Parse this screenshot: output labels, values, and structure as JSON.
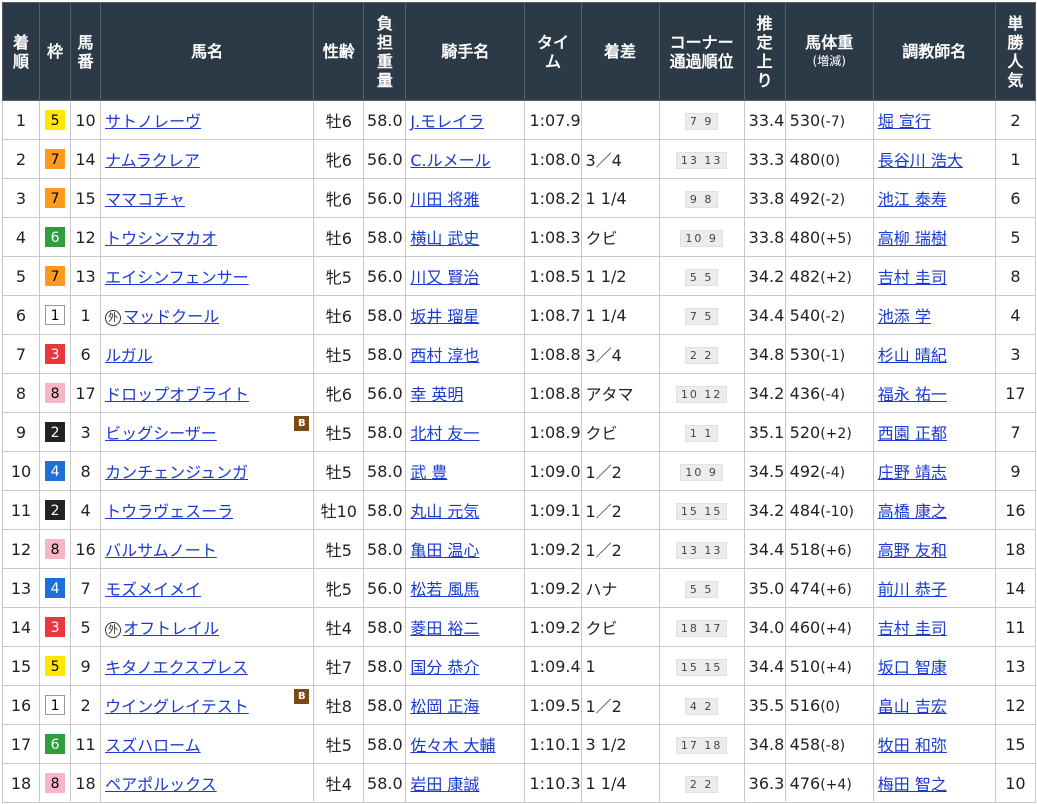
{
  "headers": {
    "rank": "着順",
    "waku": "枠",
    "umaban": "馬番",
    "horse": "馬名",
    "sexage": "性齢",
    "weight": "負担重量",
    "jockey": "騎手名",
    "time": "タイム",
    "margin": "着差",
    "corner_line1": "コーナー",
    "corner_line2": "通過順位",
    "last3f": "推定上り",
    "bodyweight": "馬体重",
    "bodyweight_sub": "(増減)",
    "trainer": "調教師名",
    "popularity": "単勝人気"
  },
  "waku_colors": {
    "1": {
      "bg": "#ffffff",
      "fg": "#000000",
      "border": "#999999"
    },
    "2": {
      "bg": "#222222",
      "fg": "#ffffff",
      "border": "#222222"
    },
    "3": {
      "bg": "#e8383d",
      "fg": "#ffffff",
      "border": "#e8383d"
    },
    "4": {
      "bg": "#1e6fd9",
      "fg": "#ffffff",
      "border": "#1e6fd9"
    },
    "5": {
      "bg": "#ffe800",
      "fg": "#000000",
      "border": "#ffe800"
    },
    "6": {
      "bg": "#2f9e3f",
      "fg": "#ffffff",
      "border": "#2f9e3f"
    },
    "7": {
      "bg": "#ff9a1f",
      "fg": "#000000",
      "border": "#ff9a1f"
    },
    "8": {
      "bg": "#f7b6c8",
      "fg": "#000000",
      "border": "#f7b6c8"
    }
  },
  "rows": [
    {
      "rank": "1",
      "waku": "5",
      "umaban": "10",
      "horse": "サトノレーヴ",
      "mark": "",
      "blinker": "",
      "sexage": "牡6",
      "weight": "58.0",
      "jockey": "J.モレイラ",
      "time": "1:07.9",
      "margin": "",
      "corner": "7 9",
      "last3f": "33.4",
      "bw": "530",
      "bwdiff": "(-7)",
      "trainer": "堀 宣行",
      "pop": "2"
    },
    {
      "rank": "2",
      "waku": "7",
      "umaban": "14",
      "horse": "ナムラクレア",
      "mark": "",
      "blinker": "",
      "sexage": "牝6",
      "weight": "56.0",
      "jockey": "C.ルメール",
      "time": "1:08.0",
      "margin": "3／4",
      "corner": "13 13",
      "last3f": "33.3",
      "bw": "480",
      "bwdiff": "(0)",
      "trainer": "長谷川 浩大",
      "pop": "1"
    },
    {
      "rank": "3",
      "waku": "7",
      "umaban": "15",
      "horse": "ママコチャ",
      "mark": "",
      "blinker": "",
      "sexage": "牝6",
      "weight": "56.0",
      "jockey": "川田 将雅",
      "time": "1:08.2",
      "margin": "1 1/4",
      "corner": "9 8",
      "last3f": "33.8",
      "bw": "492",
      "bwdiff": "(-2)",
      "trainer": "池江 泰寿",
      "pop": "6"
    },
    {
      "rank": "4",
      "waku": "6",
      "umaban": "12",
      "horse": "トウシンマカオ",
      "mark": "",
      "blinker": "",
      "sexage": "牡6",
      "weight": "58.0",
      "jockey": "横山 武史",
      "time": "1:08.3",
      "margin": "クビ",
      "corner": "10 9",
      "last3f": "33.8",
      "bw": "480",
      "bwdiff": "(+5)",
      "trainer": "高柳 瑞樹",
      "pop": "5"
    },
    {
      "rank": "5",
      "waku": "7",
      "umaban": "13",
      "horse": "エイシンフェンサー",
      "mark": "",
      "blinker": "",
      "sexage": "牝5",
      "weight": "56.0",
      "jockey": "川又 賢治",
      "time": "1:08.5",
      "margin": "1 1/2",
      "corner": "5 5",
      "last3f": "34.2",
      "bw": "482",
      "bwdiff": "(+2)",
      "trainer": "吉村 圭司",
      "pop": "8"
    },
    {
      "rank": "6",
      "waku": "1",
      "umaban": "1",
      "horse": "マッドクール",
      "mark": "外",
      "blinker": "",
      "sexage": "牡6",
      "weight": "58.0",
      "jockey": "坂井 瑠星",
      "time": "1:08.7",
      "margin": "1 1/4",
      "corner": "7 5",
      "last3f": "34.4",
      "bw": "540",
      "bwdiff": "(-2)",
      "trainer": "池添 学",
      "pop": "4"
    },
    {
      "rank": "7",
      "waku": "3",
      "umaban": "6",
      "horse": "ルガル",
      "mark": "",
      "blinker": "",
      "sexage": "牡5",
      "weight": "58.0",
      "jockey": "西村 淳也",
      "time": "1:08.8",
      "margin": "3／4",
      "corner": "2 2",
      "last3f": "34.8",
      "bw": "530",
      "bwdiff": "(-1)",
      "trainer": "杉山 晴紀",
      "pop": "3"
    },
    {
      "rank": "8",
      "waku": "8",
      "umaban": "17",
      "horse": "ドロップオブライト",
      "mark": "",
      "blinker": "",
      "sexage": "牝6",
      "weight": "56.0",
      "jockey": "幸 英明",
      "time": "1:08.8",
      "margin": "アタマ",
      "corner": "10 12",
      "last3f": "34.2",
      "bw": "436",
      "bwdiff": "(-4)",
      "trainer": "福永 祐一",
      "pop": "17"
    },
    {
      "rank": "9",
      "waku": "2",
      "umaban": "3",
      "horse": "ビッグシーザー",
      "mark": "",
      "blinker": "B",
      "sexage": "牡5",
      "weight": "58.0",
      "jockey": "北村 友一",
      "time": "1:08.9",
      "margin": "クビ",
      "corner": "1 1",
      "last3f": "35.1",
      "bw": "520",
      "bwdiff": "(+2)",
      "trainer": "西園 正都",
      "pop": "7"
    },
    {
      "rank": "10",
      "waku": "4",
      "umaban": "8",
      "horse": "カンチェンジュンガ",
      "mark": "",
      "blinker": "",
      "sexage": "牡5",
      "weight": "58.0",
      "jockey": "武 豊",
      "time": "1:09.0",
      "margin": "1／2",
      "corner": "10 9",
      "last3f": "34.5",
      "bw": "492",
      "bwdiff": "(-4)",
      "trainer": "庄野 靖志",
      "pop": "9"
    },
    {
      "rank": "11",
      "waku": "2",
      "umaban": "4",
      "horse": "トウラヴェスーラ",
      "mark": "",
      "blinker": "",
      "sexage": "牡10",
      "weight": "58.0",
      "jockey": "丸山 元気",
      "time": "1:09.1",
      "margin": "1／2",
      "corner": "15 15",
      "last3f": "34.2",
      "bw": "484",
      "bwdiff": "(-10)",
      "trainer": "高橋 康之",
      "pop": "16"
    },
    {
      "rank": "12",
      "waku": "8",
      "umaban": "16",
      "horse": "バルサムノート",
      "mark": "",
      "blinker": "",
      "sexage": "牡5",
      "weight": "58.0",
      "jockey": "亀田 温心",
      "time": "1:09.2",
      "margin": "1／2",
      "corner": "13 13",
      "last3f": "34.4",
      "bw": "518",
      "bwdiff": "(+6)",
      "trainer": "高野 友和",
      "pop": "18"
    },
    {
      "rank": "13",
      "waku": "4",
      "umaban": "7",
      "horse": "モズメイメイ",
      "mark": "",
      "blinker": "",
      "sexage": "牝5",
      "weight": "56.0",
      "jockey": "松若 風馬",
      "time": "1:09.2",
      "margin": "ハナ",
      "corner": "5 5",
      "last3f": "35.0",
      "bw": "474",
      "bwdiff": "(+6)",
      "trainer": "前川 恭子",
      "pop": "14"
    },
    {
      "rank": "14",
      "waku": "3",
      "umaban": "5",
      "horse": "オフトレイル",
      "mark": "外",
      "blinker": "",
      "sexage": "牡4",
      "weight": "58.0",
      "jockey": "菱田 裕二",
      "time": "1:09.2",
      "margin": "クビ",
      "corner": "18 17",
      "last3f": "34.0",
      "bw": "460",
      "bwdiff": "(+4)",
      "trainer": "吉村 圭司",
      "pop": "11"
    },
    {
      "rank": "15",
      "waku": "5",
      "umaban": "9",
      "horse": "キタノエクスプレス",
      "mark": "",
      "blinker": "",
      "sexage": "牡7",
      "weight": "58.0",
      "jockey": "国分 恭介",
      "time": "1:09.4",
      "margin": "1",
      "corner": "15 15",
      "last3f": "34.4",
      "bw": "510",
      "bwdiff": "(+4)",
      "trainer": "坂口 智康",
      "pop": "13"
    },
    {
      "rank": "16",
      "waku": "1",
      "umaban": "2",
      "horse": "ウイングレイテスト",
      "mark": "",
      "blinker": "B",
      "sexage": "牡8",
      "weight": "58.0",
      "jockey": "松岡 正海",
      "time": "1:09.5",
      "margin": "1／2",
      "corner": "4 2",
      "last3f": "35.5",
      "bw": "516",
      "bwdiff": "(0)",
      "trainer": "畠山 吉宏",
      "pop": "12"
    },
    {
      "rank": "17",
      "waku": "6",
      "umaban": "11",
      "horse": "スズハローム",
      "mark": "",
      "blinker": "",
      "sexage": "牡5",
      "weight": "58.0",
      "jockey": "佐々木 大輔",
      "time": "1:10.1",
      "margin": "3 1/2",
      "corner": "17 18",
      "last3f": "34.8",
      "bw": "458",
      "bwdiff": "(-8)",
      "trainer": "牧田 和弥",
      "pop": "15"
    },
    {
      "rank": "18",
      "waku": "8",
      "umaban": "18",
      "horse": "ペアポルックス",
      "mark": "",
      "blinker": "",
      "sexage": "牡4",
      "weight": "58.0",
      "jockey": "岩田 康誠",
      "time": "1:10.3",
      "margin": "1 1/4",
      "corner": "2 2",
      "last3f": "36.3",
      "bw": "476",
      "bwdiff": "(+4)",
      "trainer": "梅田 智之",
      "pop": "10"
    }
  ]
}
